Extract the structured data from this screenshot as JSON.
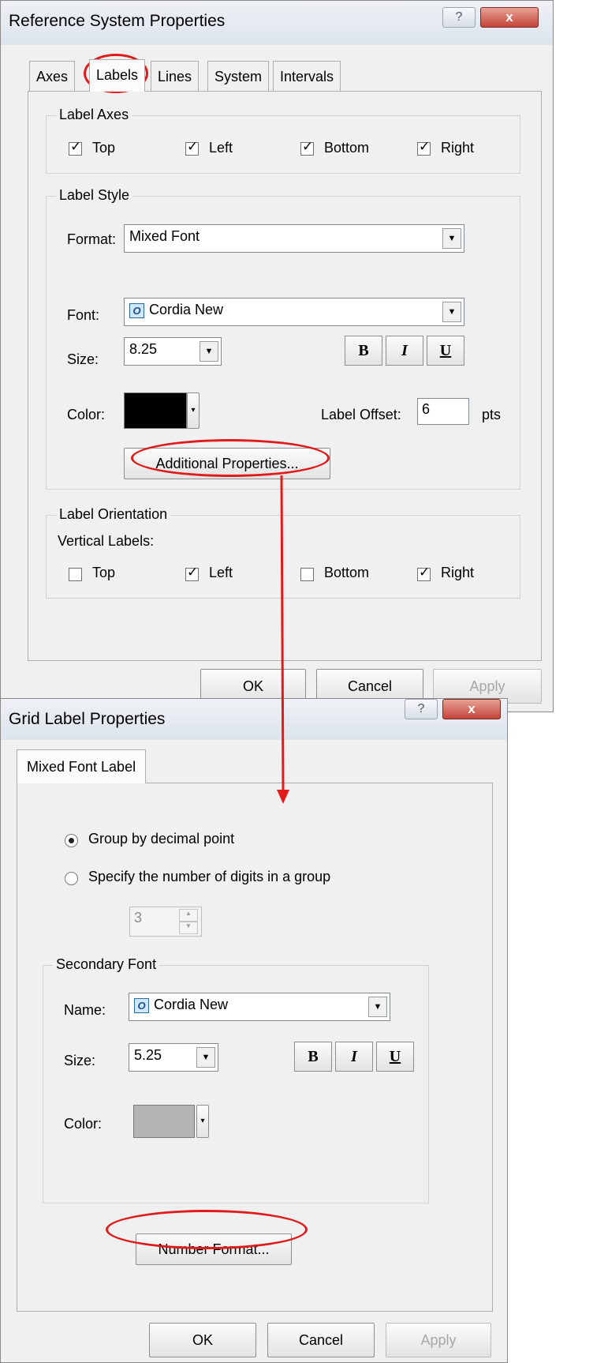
{
  "ref_dialog": {
    "title": "Reference System Properties",
    "help_glyph": "?",
    "close_glyph": "x",
    "tabs": [
      {
        "label": "Axes"
      },
      {
        "label": "Labels"
      },
      {
        "label": "Lines"
      },
      {
        "label": "System"
      },
      {
        "label": "Intervals"
      }
    ],
    "label_axes": {
      "title": "Label Axes",
      "items": [
        {
          "label": "Top",
          "checked": true
        },
        {
          "label": "Left",
          "checked": true
        },
        {
          "label": "Bottom",
          "checked": true
        },
        {
          "label": "Right",
          "checked": true
        }
      ]
    },
    "label_style": {
      "title": "Label Style",
      "format_label": "Format:",
      "format_value": "Mixed Font",
      "font_label": "Font:",
      "font_value": "Cordia New",
      "size_label": "Size:",
      "size_value": "8.25",
      "bold": "B",
      "italic": "I",
      "underline": "U",
      "color_label": "Color:",
      "color_value": "#000000",
      "offset_label": "Label Offset:",
      "offset_value": "6",
      "offset_unit": "pts",
      "additional_button": "Additional Properties..."
    },
    "label_orientation": {
      "title": "Label Orientation",
      "vertical_label": "Vertical Labels:",
      "items": [
        {
          "label": "Top",
          "checked": false
        },
        {
          "label": "Left",
          "checked": true
        },
        {
          "label": "Bottom",
          "checked": false
        },
        {
          "label": "Right",
          "checked": true
        }
      ]
    },
    "ok": "OK",
    "cancel": "Cancel",
    "apply": "Apply"
  },
  "grid_dialog": {
    "title": "Grid Label Properties",
    "help_glyph": "?",
    "close_glyph": "x",
    "tab": "Mixed Font Label",
    "radio_group_by": "Group by decimal point",
    "radio_specify": "Specify the number of digits in a group",
    "digits_value": "3",
    "secondary_font": {
      "title": "Secondary Font",
      "name_label": "Name:",
      "name_value": "Cordia New",
      "size_label": "Size:",
      "size_value": "5.25",
      "bold": "B",
      "italic": "I",
      "underline": "U",
      "color_label": "Color:",
      "color_value": "#b3b3b3"
    },
    "number_format_button": "Number Format...",
    "ok": "OK",
    "cancel": "Cancel",
    "apply": "Apply"
  },
  "annotation_color": "#e01b1b"
}
